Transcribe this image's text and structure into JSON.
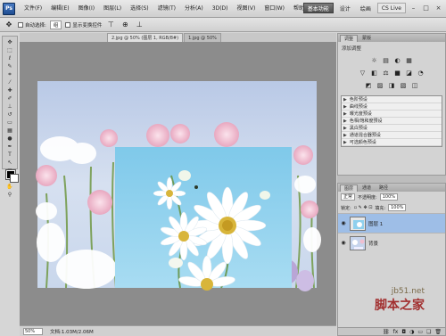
{
  "menubar": {
    "logo": "Ps",
    "items": [
      "文件(F)",
      "编辑(E)",
      "图像(I)",
      "图层(L)",
      "选择(S)",
      "滤镜(T)",
      "分析(A)",
      "3D(D)",
      "视图(V)",
      "窗口(W)",
      "帮助(H)"
    ],
    "zoom": "50%",
    "workspace_active": "基本功能",
    "workspace_items": [
      "设计",
      "绘画"
    ],
    "cs_live": "CS Live"
  },
  "options": {
    "auto_select_label": "自动选择:",
    "auto_select_value": "组",
    "transform_label": "显示变换控件"
  },
  "document": {
    "tabs": [
      "2.jpg @ 50% (图层 1, RGB/8#)",
      "1.jpg @ 50%"
    ],
    "zoom": "50%",
    "doc_info": "文档:1.03M/2.06M"
  },
  "adjustments": {
    "tabs": [
      "调整",
      "蒙版"
    ],
    "title": "添加调整",
    "icons_row1": [
      "☼",
      "▤",
      "◐",
      "▦"
    ],
    "icons_row2": [
      "▽",
      "◧",
      "⚖",
      "■",
      "◪",
      "◔"
    ],
    "icons_row3": [
      "◩",
      "▨",
      "◨",
      "▧",
      "◫"
    ],
    "presets": [
      "色阶预设",
      "曲线预设",
      "曝光度预设",
      "色相/饱和度预设",
      "黑白预设",
      "通道混合器预设",
      "可选颜色预设"
    ]
  },
  "layers": {
    "tabs": [
      "图层",
      "通道",
      "路径"
    ],
    "blend_mode": "正常",
    "opacity_label": "不透明度:",
    "opacity": "100%",
    "lock_label": "锁定:",
    "fill_label": "填充:",
    "fill": "100%",
    "items": [
      {
        "name": "图层 1",
        "selected": true
      },
      {
        "name": "背景",
        "selected": false
      }
    ]
  },
  "watermark": {
    "url": "jb51.net",
    "name": "脚本之家"
  }
}
